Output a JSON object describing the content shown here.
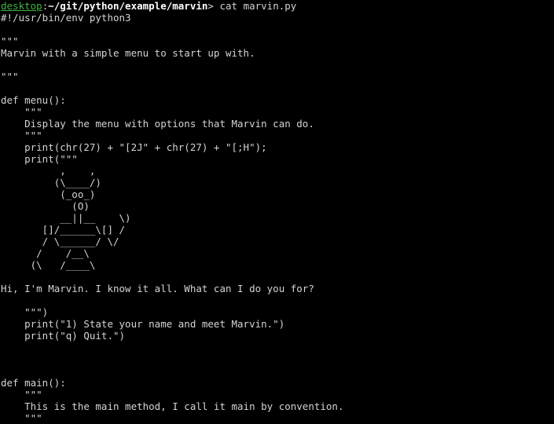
{
  "prompt": {
    "host": "desktop",
    "separator": ":",
    "path": "~/git/python/example/marvin",
    "symbol": ">",
    "command": " cat marvin.py"
  },
  "file_lines": [
    "#!/usr/bin/env python3",
    "",
    "\"\"\"",
    "Marvin with a simple menu to start up with.",
    "",
    "\"\"\"",
    "",
    "def menu():",
    "    \"\"\"",
    "    Display the menu with options that Marvin can do.",
    "    \"\"\"",
    "    print(chr(27) + \"[2J\" + chr(27) + \"[;H\");",
    "    print(\"\"\"",
    "          ,    ,",
    "         (\\____/)",
    "          (_oo_)",
    "            (O)",
    "          __||__    \\)",
    "       []/______\\[] /",
    "       / \\______/ \\/",
    "      /    /__\\",
    "     (\\   /____\\",
    "",
    "Hi, I'm Marvin. I know it all. What can I do you for?",
    "",
    "    \"\"\")",
    "    print(\"1) State your name and meet Marvin.\")",
    "    print(\"q) Quit.\")",
    "",
    "",
    "",
    "def main():",
    "    \"\"\"",
    "    This is the main method, I call it main by convention.",
    "    \"\"\""
  ]
}
